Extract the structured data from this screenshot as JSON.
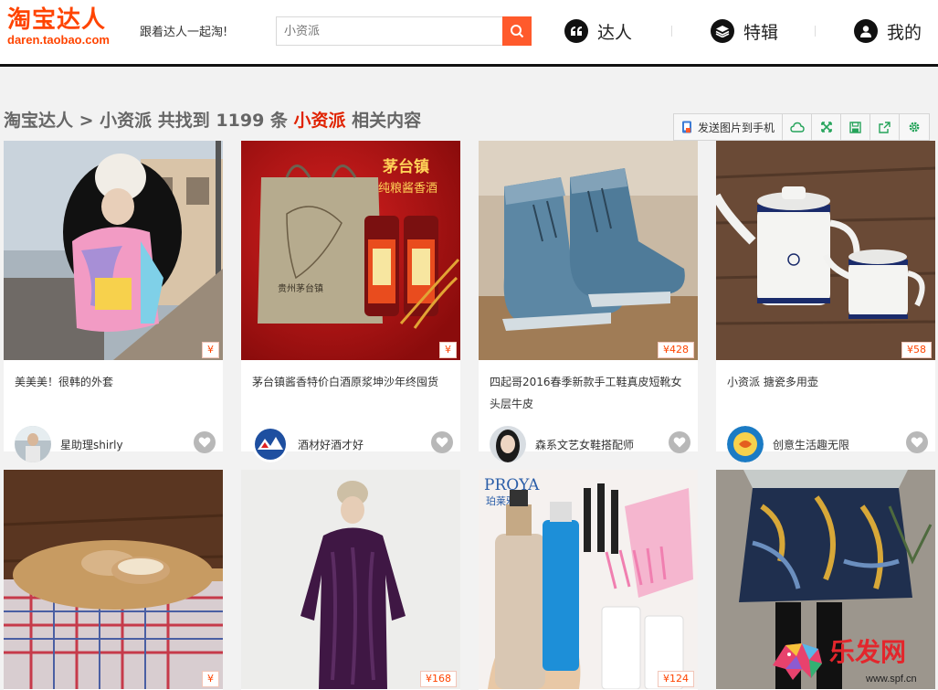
{
  "header": {
    "logo_main": "淘宝达人",
    "logo_sub": "daren.taobao.com",
    "slogan": "跟着达人一起淘!",
    "search_placeholder": "小资派",
    "nav": [
      {
        "label": "达人",
        "icon": "quote-icon"
      },
      {
        "label": "特辑",
        "icon": "layers-icon"
      },
      {
        "label": "我的",
        "icon": "user-icon"
      }
    ]
  },
  "breadcrumb": {
    "root": "淘宝达人",
    "sep": " > ",
    "current": "小资派",
    "found_prefix": " 共找到 ",
    "count": "1199",
    "unit": " 条 ",
    "keyword": "小资派",
    "suffix": " 相关内容"
  },
  "toolbar": {
    "send_label": "发送图片到手机",
    "buttons": [
      "cloud-icon",
      "expand-icon",
      "save-icon",
      "share-icon",
      "settings-icon"
    ]
  },
  "cards": [
    {
      "title": "美美美！很韩的外套",
      "price": "¥",
      "user": "星助理shirly"
    },
    {
      "title": "茅台镇酱香特价白酒原浆坤沙年终囤货",
      "price": "¥",
      "user": "酒材好酒才好",
      "img_text_1": "茅台镇",
      "img_text_2": "纯粮酱香酒"
    },
    {
      "title": "四起哥2016春季新款手工鞋真皮短靴女头层牛皮",
      "price": "¥428",
      "user": "森系文艺女鞋搭配师"
    },
    {
      "title": "小资派 搪瓷多用壶",
      "price": "¥58",
      "user": "创意生活趣无限"
    },
    {
      "price": "¥"
    },
    {
      "price": "¥168"
    },
    {
      "price": "¥124",
      "brand_en": "PROYA",
      "brand_cn": "珀莱雅"
    },
    {}
  ],
  "watermark": {
    "text": "乐发网",
    "url": "www.spf.cn"
  }
}
